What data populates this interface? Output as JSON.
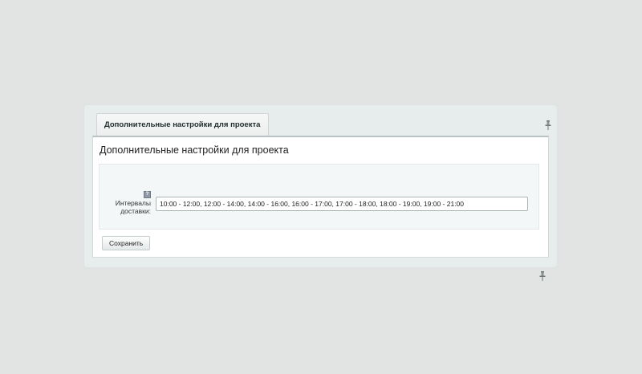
{
  "tabs": [
    {
      "label": "Дополнительные настройки для проекта",
      "active": true
    }
  ],
  "form": {
    "title": "Дополнительные настройки для проекта",
    "fields": [
      {
        "label_line1": "Интервалы",
        "label_line2": "доставки:",
        "help_icon": "?",
        "value": "10:00 - 12:00, 12:00 - 14:00, 14:00 - 16:00, 16:00 - 17:00, 17:00 - 18:00, 18:00 - 19:00, 19:00 - 21:00"
      }
    ],
    "save_label": "Сохранить"
  },
  "icons": {
    "pin": "pin-icon",
    "help": "help-icon"
  },
  "colors": {
    "page_background": "#e2e3e3",
    "panel_background": "#e7ecec",
    "fieldset_background": "#f4f7f7"
  }
}
